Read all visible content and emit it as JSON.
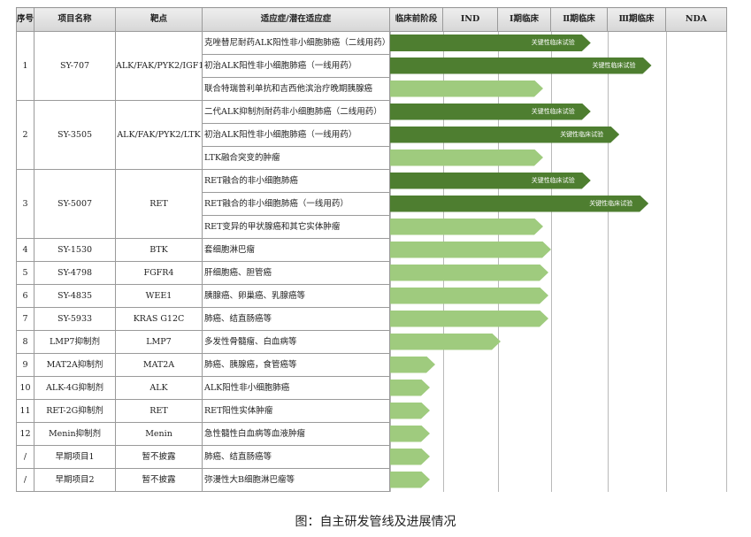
{
  "header": {
    "seq": "序号",
    "name": "项目名称",
    "target": "靶点",
    "indication": "适应症/潜在适应症",
    "stages": [
      "临床前阶段",
      "IND",
      "Ⅰ期临床",
      "Ⅱ期临床",
      "Ⅲ期临床",
      "NDA"
    ]
  },
  "groups": [
    {
      "seq": "1",
      "name": "SY-707",
      "target": "ALK/FAK/PYK2/IGF1R",
      "rows": [
        {
          "indication": "克唑替尼耐药ALK阳性非小细胞肺癌（二线用药）",
          "bar_stages": 3.7,
          "bar_tone": "dark",
          "bar_label": "关键性临床试验"
        },
        {
          "indication": "初治ALK阳性非小细胞肺癌（一线用药）",
          "bar_stages": 4.75,
          "bar_tone": "dark",
          "bar_label": "关键性临床试验"
        },
        {
          "indication": "联合特瑞普利单抗和吉西他滨治疗晚期胰腺癌",
          "bar_stages": 2.85,
          "bar_tone": "light",
          "bar_label": ""
        }
      ]
    },
    {
      "seq": "2",
      "name": "SY-3505",
      "target": "ALK/FAK/PYK2/LTK",
      "rows": [
        {
          "indication": "二代ALK抑制剂耐药非小细胞肺癌（二线用药）",
          "bar_stages": 3.7,
          "bar_tone": "dark",
          "bar_label": "关键性临床试验"
        },
        {
          "indication": "初治ALK阳性非小细胞肺癌（一线用药）",
          "bar_stages": 4.2,
          "bar_tone": "dark",
          "bar_label": "关键性临床试验"
        },
        {
          "indication": "LTK融合突变的肿瘤",
          "bar_stages": 2.85,
          "bar_tone": "light",
          "bar_label": ""
        }
      ]
    },
    {
      "seq": "3",
      "name": "SY-5007",
      "target": "RET",
      "rows": [
        {
          "indication": "RET融合的非小细胞肺癌",
          "bar_stages": 3.7,
          "bar_tone": "dark",
          "bar_label": "关键性临床试验"
        },
        {
          "indication": "RET融合的非小细胞肺癌（一线用药）",
          "bar_stages": 4.7,
          "bar_tone": "dark",
          "bar_label": "关键性临床试验"
        },
        {
          "indication": "RET变异的甲状腺癌和其它实体肿瘤",
          "bar_stages": 2.85,
          "bar_tone": "light",
          "bar_label": ""
        }
      ]
    },
    {
      "seq": "4",
      "name": "SY-1530",
      "target": "BTK",
      "rows": [
        {
          "indication": "套细胞淋巴瘤",
          "bar_stages": 3.0,
          "bar_tone": "light",
          "bar_label": ""
        }
      ]
    },
    {
      "seq": "5",
      "name": "SY-4798",
      "target": "FGFR4",
      "rows": [
        {
          "indication": "肝细胞癌、胆管癌",
          "bar_stages": 2.95,
          "bar_tone": "light",
          "bar_label": ""
        }
      ]
    },
    {
      "seq": "6",
      "name": "SY-4835",
      "target": "WEE1",
      "rows": [
        {
          "indication": "胰腺癌、卵巢癌、乳腺癌等",
          "bar_stages": 2.95,
          "bar_tone": "light",
          "bar_label": ""
        }
      ]
    },
    {
      "seq": "7",
      "name": "SY-5933",
      "target": "KRAS G12C",
      "rows": [
        {
          "indication": "肺癌、结直肠癌等",
          "bar_stages": 2.95,
          "bar_tone": "light",
          "bar_label": ""
        }
      ]
    },
    {
      "seq": "8",
      "name": "LMP7抑制剂",
      "target": "LMP7",
      "rows": [
        {
          "indication": "多发性骨髓瘤、白血病等",
          "bar_stages": 2.05,
          "bar_tone": "light",
          "bar_label": ""
        }
      ]
    },
    {
      "seq": "9",
      "name": "MAT2A抑制剂",
      "target": "MAT2A",
      "rows": [
        {
          "indication": "肺癌、胰腺癌，食管癌等",
          "bar_stages": 0.85,
          "bar_tone": "light",
          "bar_label": ""
        }
      ]
    },
    {
      "seq": "10",
      "name": "ALK-4G抑制剂",
      "target": "ALK",
      "rows": [
        {
          "indication": "ALK阳性非小细胞肺癌",
          "bar_stages": 0.75,
          "bar_tone": "light",
          "bar_label": ""
        }
      ]
    },
    {
      "seq": "11",
      "name": "RET-2G抑制剂",
      "target": "RET",
      "rows": [
        {
          "indication": "RET阳性实体肿瘤",
          "bar_stages": 0.75,
          "bar_tone": "light",
          "bar_label": ""
        }
      ]
    },
    {
      "seq": "12",
      "name": "Menin抑制剂",
      "target": "Menin",
      "rows": [
        {
          "indication": "急性髓性白血病等血液肿瘤",
          "bar_stages": 0.75,
          "bar_tone": "light",
          "bar_label": ""
        }
      ]
    },
    {
      "seq": "/",
      "name": "早期项目1",
      "target": "暂不披露",
      "rows": [
        {
          "indication": "肺癌、结直肠癌等",
          "bar_stages": 0.75,
          "bar_tone": "light",
          "bar_label": ""
        }
      ]
    },
    {
      "seq": "/",
      "name": "早期项目2",
      "target": "暂不披露",
      "rows": [
        {
          "indication": "弥漫性大B细胞淋巴瘤等",
          "bar_stages": 0.75,
          "bar_tone": "light",
          "bar_label": ""
        }
      ]
    }
  ],
  "colors": {
    "bar_dark": "#4e7e30",
    "bar_light": "#9fcb7e",
    "header_bg": "#e2e2e2",
    "grid": "#9a9a9a"
  },
  "caption": "图：自主研发管线及进展情况"
}
